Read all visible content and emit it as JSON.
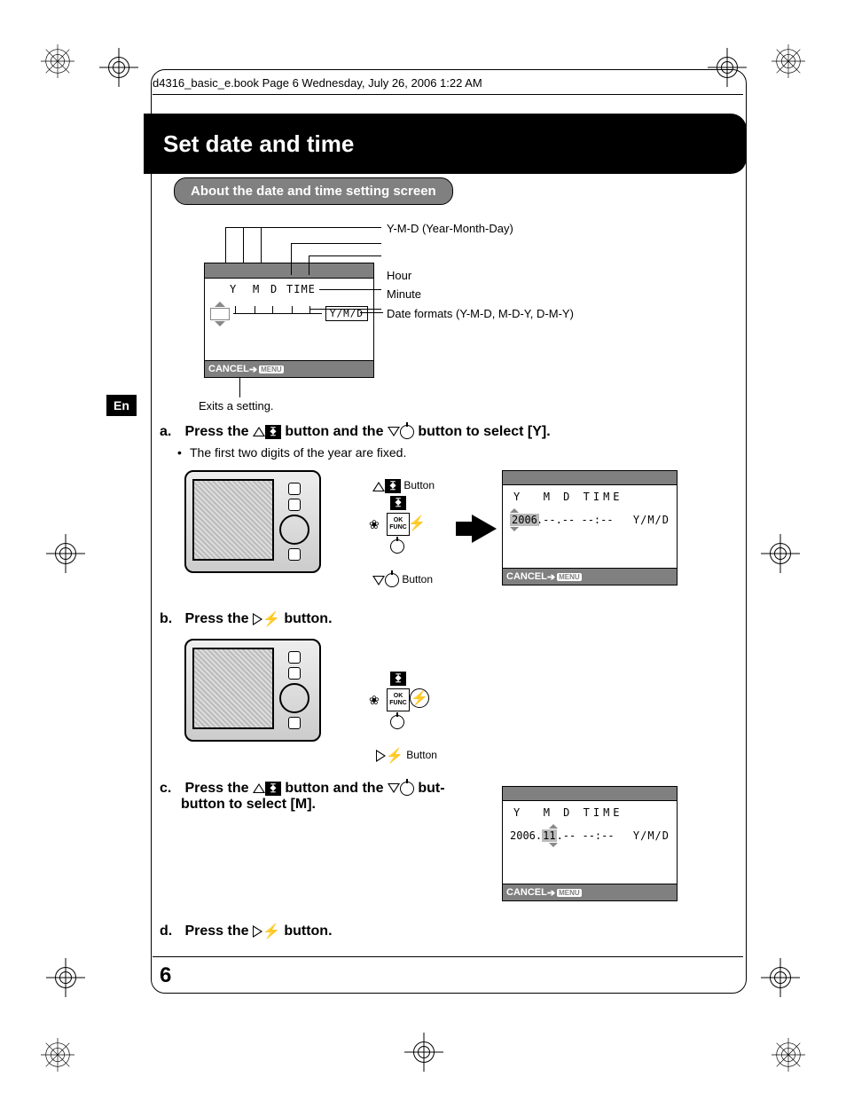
{
  "header": "d4316_basic_e.book  Page 6  Wednesday, July 26, 2006  1:22 AM",
  "lang_tab": "En",
  "section_title": "Set date and time",
  "subsection_title": "About the date and time setting screen",
  "diagram_labels": {
    "ymd": "Y-M-D (Year-Month-Day)",
    "hour": "Hour",
    "minute": "Minute",
    "formats": "Date formats (Y-M-D, M-D-Y, D-M-Y)",
    "exits": "Exits a setting."
  },
  "lcd_common": {
    "header_y": "Y",
    "header_m": "M",
    "header_d": "D",
    "header_time": "TIME",
    "format_box": "Y/M/D",
    "cancel": "CANCEL",
    "menu": "MENU"
  },
  "steps": {
    "a": {
      "pre": "Press the ",
      "mid": " button and the ",
      "post": " button to select [Y].",
      "note": "The first two digits of the year are fixed.",
      "btn_up_label": " Button",
      "btn_dn_label": " Button",
      "lcd_row2": "2006.--.-- --:--"
    },
    "b": {
      "pre": "Press the ",
      "post": " button.",
      "btn_label": " Button"
    },
    "c": {
      "pre": "Press the ",
      "mid": " button and the ",
      "post": " button to select [M].",
      "lcd_row2_a": "2006.",
      "lcd_row2_sel": "11",
      "lcd_row2_b": ".-- --:--"
    },
    "d": {
      "pre": "Press the ",
      "post": " button."
    }
  },
  "dpad_center_top": "OK",
  "dpad_center_bot": "FUNC",
  "page_number": "6"
}
